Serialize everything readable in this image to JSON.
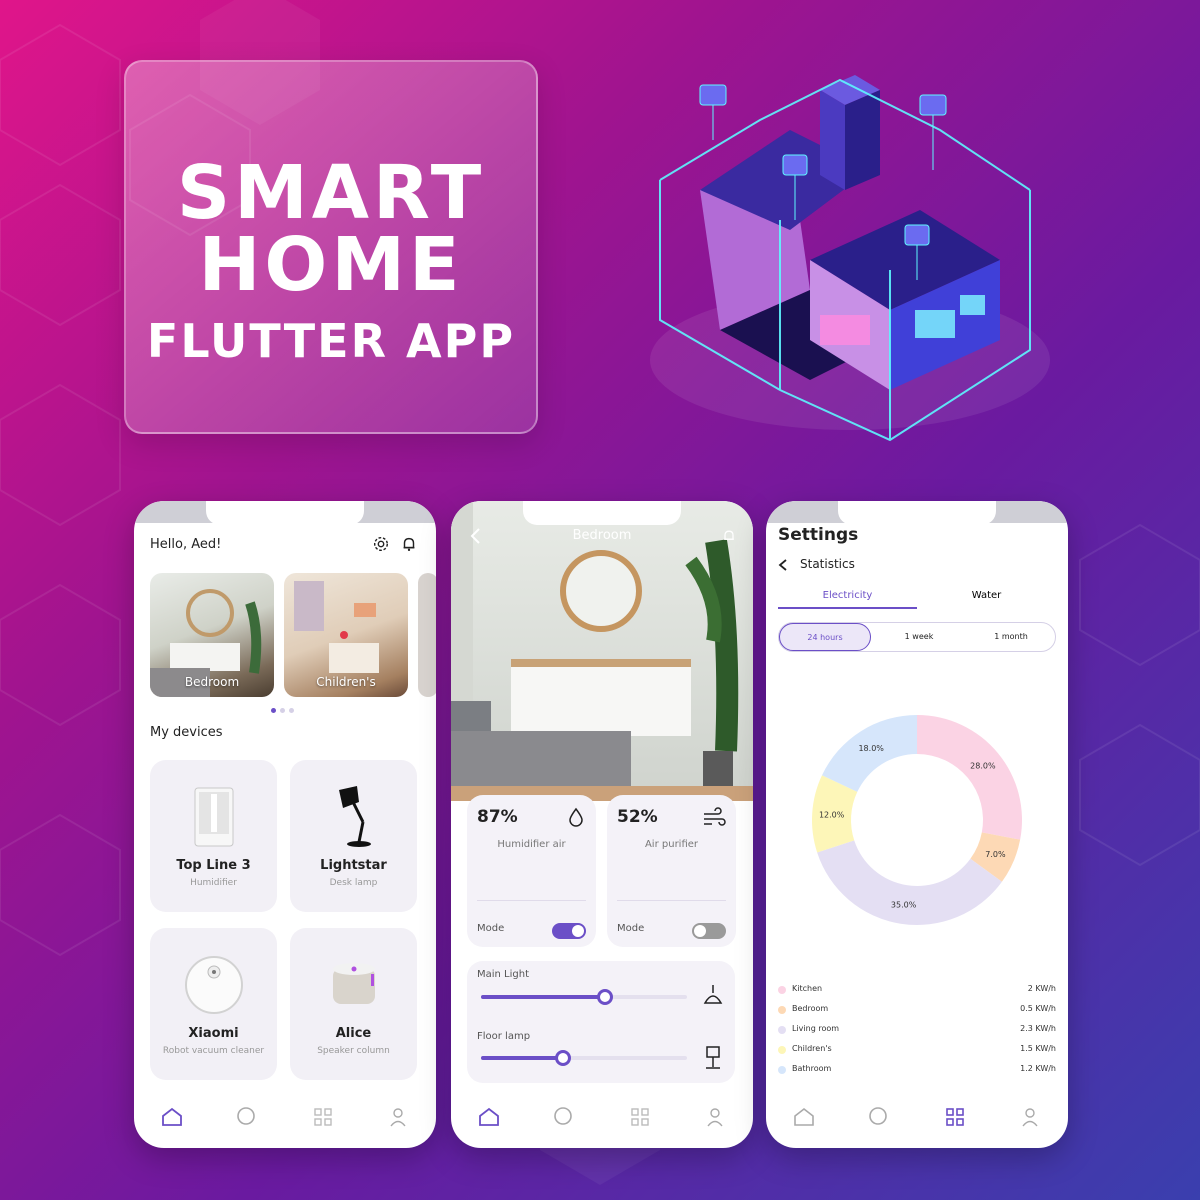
{
  "promo": {
    "title_line1": "SMART",
    "title_line2": "HOME",
    "subtitle": "FLUTTER APP"
  },
  "phone1": {
    "greeting": "Hello, Aed!",
    "rooms": [
      {
        "label": "Bedroom"
      },
      {
        "label": "Children's"
      }
    ],
    "section_title": "My devices",
    "devices": [
      {
        "name": "Top Line 3",
        "type": "Humidifier",
        "icon": "humidifier-icon"
      },
      {
        "name": "Lightstar",
        "type": "Desk lamp",
        "icon": "desk-lamp-icon"
      },
      {
        "name": "Xiaomi",
        "type": "Robot vacuum cleaner",
        "icon": "robot-vacuum-icon"
      },
      {
        "name": "Alice",
        "type": "Speaker column",
        "icon": "speaker-icon"
      }
    ]
  },
  "phone2": {
    "title": "Bedroom",
    "sensors": [
      {
        "value": "87%",
        "label": "Humidifier air",
        "mode_label": "Mode",
        "mode_on": true
      },
      {
        "value": "52%",
        "label": "Air purifier",
        "mode_label": "Mode",
        "mode_on": false
      }
    ],
    "lights": [
      {
        "label": "Main Light",
        "level": 0.6
      },
      {
        "label": "Floor lamp",
        "level": 0.4
      }
    ]
  },
  "phone3": {
    "title": "Settings",
    "subtitle": "Statistics",
    "tabs": [
      {
        "label": "Electricity",
        "active": true
      },
      {
        "label": "Water",
        "active": false
      }
    ],
    "ranges": [
      {
        "label": "24 hours",
        "active": true
      },
      {
        "label": "1 week",
        "active": false
      },
      {
        "label": "1 month",
        "active": false
      }
    ]
  },
  "chart_data": {
    "type": "pie",
    "donut": true,
    "categories": [
      "Kitchen",
      "Bedroom",
      "Living room",
      "Children's",
      "Bathroom"
    ],
    "values": [
      28.0,
      7.0,
      35.0,
      12.0,
      18.0
    ],
    "value_labels": [
      "28.0%",
      "7.0%",
      "35.0%",
      "12.0%",
      "18.0%"
    ],
    "legend_values": [
      "2 KW/h",
      "0.5 KW/h",
      "2.3 KW/h",
      "1.5 KW/h",
      "1.2 KW/h"
    ],
    "colors": [
      "#fbd3e4",
      "#fdd9b5",
      "#e4dff3",
      "#fdf6b8",
      "#d6e6fb"
    ],
    "legend_position": "bottom"
  },
  "colors": {
    "accent": "#6b4fc7",
    "card_bg": "#f2f0f6"
  }
}
